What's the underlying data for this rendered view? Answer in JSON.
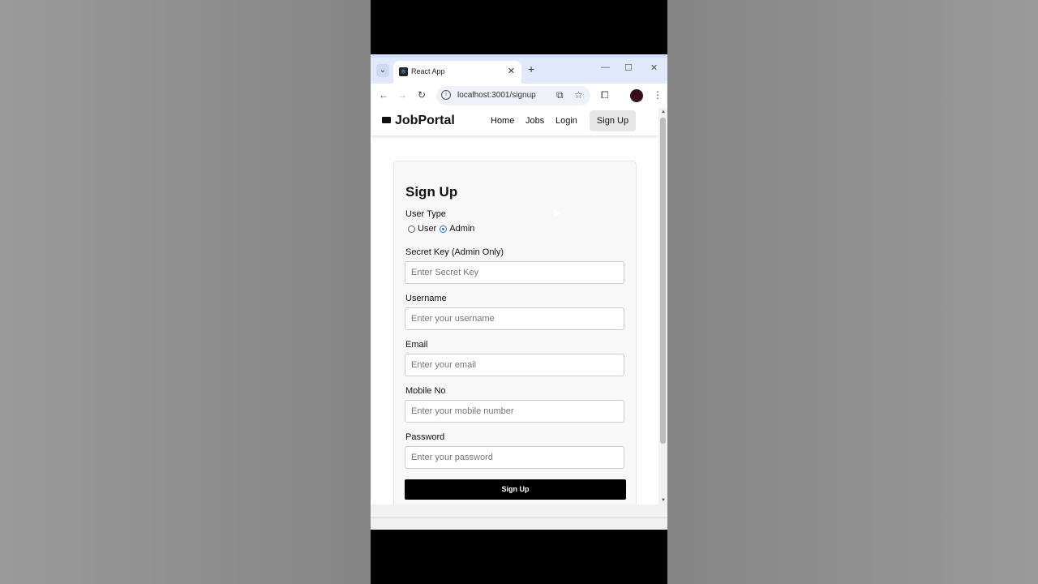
{
  "browser": {
    "tab_title": "React App",
    "url": "localhost:3001/signup"
  },
  "navbar": {
    "brand": "JobPortal",
    "links": [
      "Home",
      "Jobs",
      "Login"
    ],
    "signup_label": "Sign Up"
  },
  "form": {
    "title": "Sign Up",
    "user_type_label": "User Type",
    "options": [
      "User",
      "Admin"
    ],
    "selected_option": "Admin",
    "secret_key_label": "Secret Key (Admin Only)",
    "secret_key_placeholder": "Enter Secret Key",
    "username_label": "Username",
    "username_placeholder": "Enter your username",
    "email_label": "Email",
    "email_placeholder": "Enter your email",
    "mobile_label": "Mobile No",
    "mobile_placeholder": "Enter your mobile number",
    "password_label": "Password",
    "password_placeholder": "Enter your password",
    "submit_label": "Sign Up"
  }
}
